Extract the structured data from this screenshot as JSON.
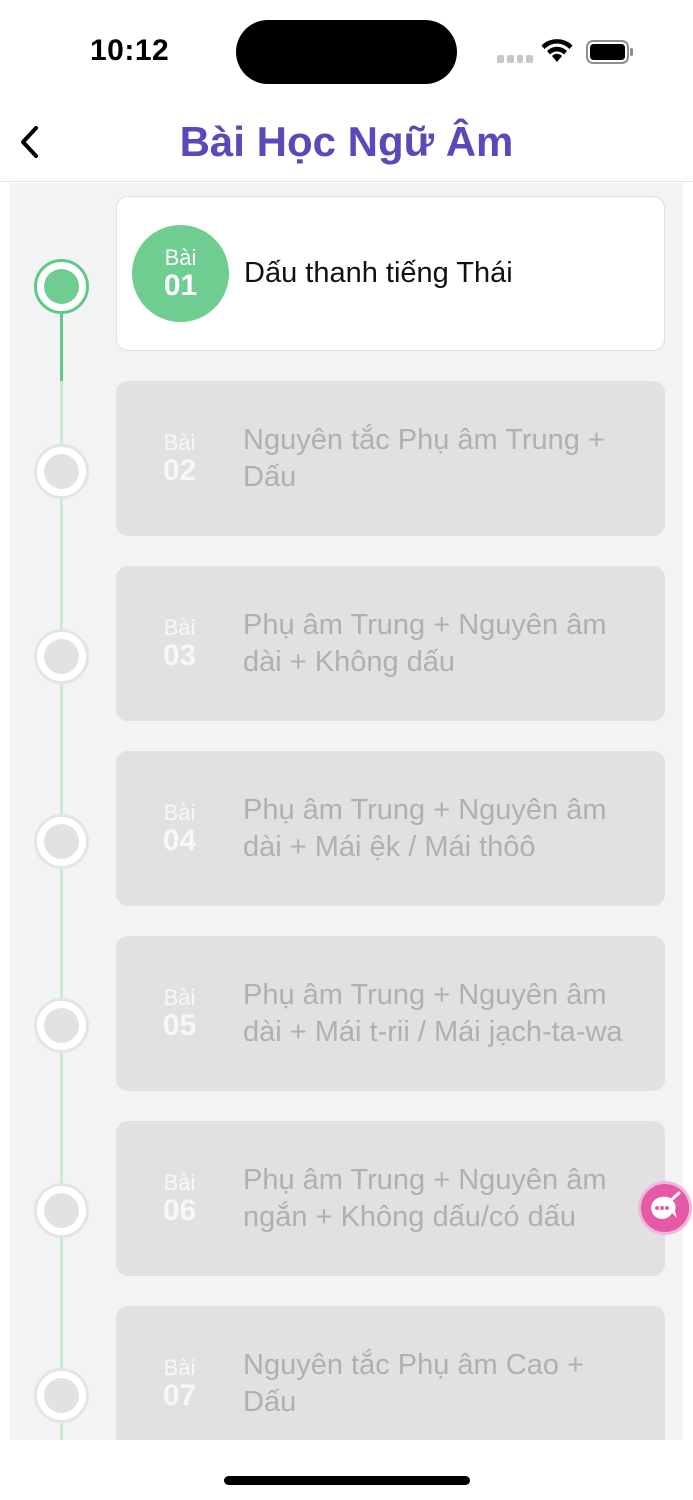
{
  "status_bar": {
    "time": "10:12",
    "icons": [
      "cellular-signal-icon",
      "wifi-icon",
      "battery-icon"
    ]
  },
  "nav": {
    "back_icon": "chevron-left-icon",
    "title": "Bài Học Ngữ Âm"
  },
  "colors": {
    "title": "#5a49b9",
    "accent_green": "#6fcd92",
    "locked_card": "#e1e1e1",
    "locked_text": "#b0b0b0",
    "fab": "#e45aa7"
  },
  "lessons": [
    {
      "prefix": "Bài",
      "number": "01",
      "title": "Dấu thanh tiếng Thái",
      "state": "unlocked"
    },
    {
      "prefix": "Bài",
      "number": "02",
      "title": "Nguyên tắc Phụ âm Trung + Dấu",
      "state": "locked"
    },
    {
      "prefix": "Bài",
      "number": "03",
      "title": "Phụ âm Trung + Nguyên âm dài + Không dấu",
      "state": "locked"
    },
    {
      "prefix": "Bài",
      "number": "04",
      "title": "Phụ âm Trung + Nguyên âm dài + Mái ệk / Mái thôô",
      "state": "locked"
    },
    {
      "prefix": "Bài",
      "number": "05",
      "title": "Phụ âm Trung + Nguyên âm dài + Mái t-rii / Mái jạch-ta-wa",
      "state": "locked"
    },
    {
      "prefix": "Bài",
      "number": "06",
      "title": "Phụ âm Trung + Nguyên âm ngắn + Không dấu/có dấu",
      "state": "locked"
    },
    {
      "prefix": "Bài",
      "number": "07",
      "title": "Nguyên tắc Phụ âm Cao + Dấu",
      "state": "locked"
    }
  ],
  "fab": {
    "icon": "translate-helper-icon"
  }
}
